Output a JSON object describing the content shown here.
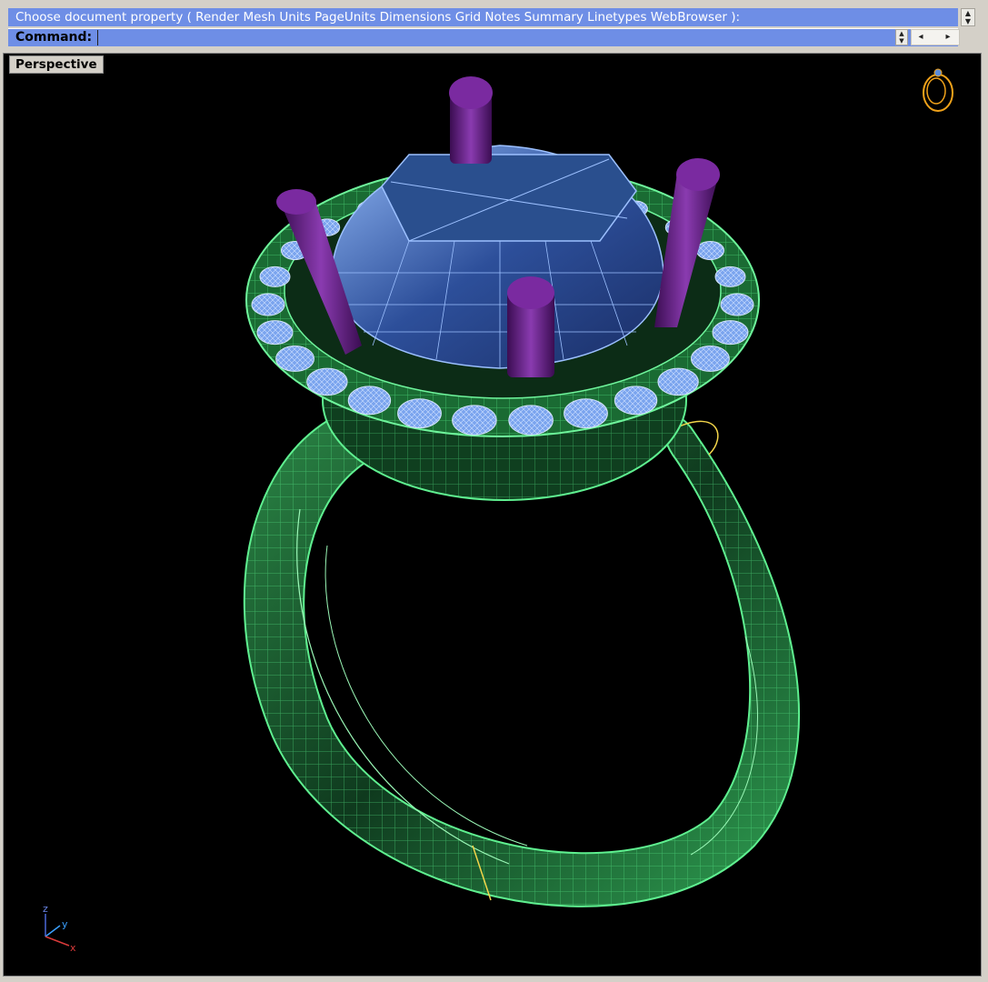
{
  "command": {
    "history_line": "Choose document property ( Render  Mesh  Units  PageUnits  Dimensions  Grid  Notes  Summary  Linetypes  WebBrowser ):",
    "label": "Command:",
    "input_value": ""
  },
  "viewport": {
    "title": "Perspective",
    "background": "#000000",
    "axes": {
      "x": "x",
      "y": "y",
      "z": "z"
    }
  },
  "colors": {
    "command_bg": "#6e8ee6",
    "band_wire": "#4ee37a",
    "band_fill": "#1f6a38",
    "stone": "#5b8cd9",
    "prong": "#5a1a77",
    "accents": "#d7c13b"
  },
  "icons": [
    "ring-preview-icon",
    "axis-gizmo-icon"
  ]
}
